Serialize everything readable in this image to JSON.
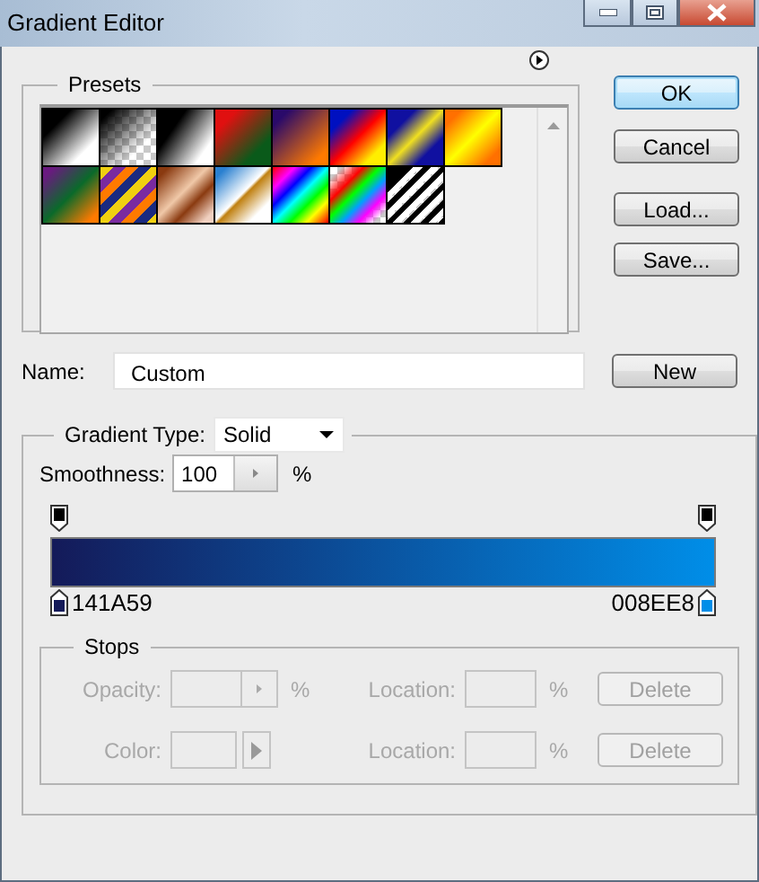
{
  "window": {
    "title": "Gradient Editor"
  },
  "presets": {
    "label": "Presets"
  },
  "buttons": [
    {
      "label": "OK",
      "default": true
    },
    {
      "label": "Cancel",
      "default": false
    },
    {
      "label": "Load...",
      "default": false
    },
    {
      "label": "Save...",
      "default": false
    }
  ],
  "name_field": {
    "label": "Name:",
    "value": "Custom"
  },
  "new_button": {
    "label": "New"
  },
  "gradient_type": {
    "label": "Gradient Type:",
    "value": "Solid"
  },
  "smoothness": {
    "label": "Smoothness:",
    "value": "100",
    "unit": "%"
  },
  "color_stops": [
    {
      "label": "141A59",
      "color": "#141a59"
    },
    {
      "label": "008EE8",
      "color": "#008ee8"
    }
  ],
  "stops": {
    "label": "Stops",
    "disabled": true,
    "rows": [
      {
        "kind": "opacity",
        "label": "Opacity:",
        "unit": "%",
        "location_label": "Location:",
        "location_unit": "%",
        "button": "Delete"
      },
      {
        "kind": "color",
        "label": "Color:",
        "location_label": "Location:",
        "location_unit": "%",
        "button": "Delete"
      }
    ]
  }
}
